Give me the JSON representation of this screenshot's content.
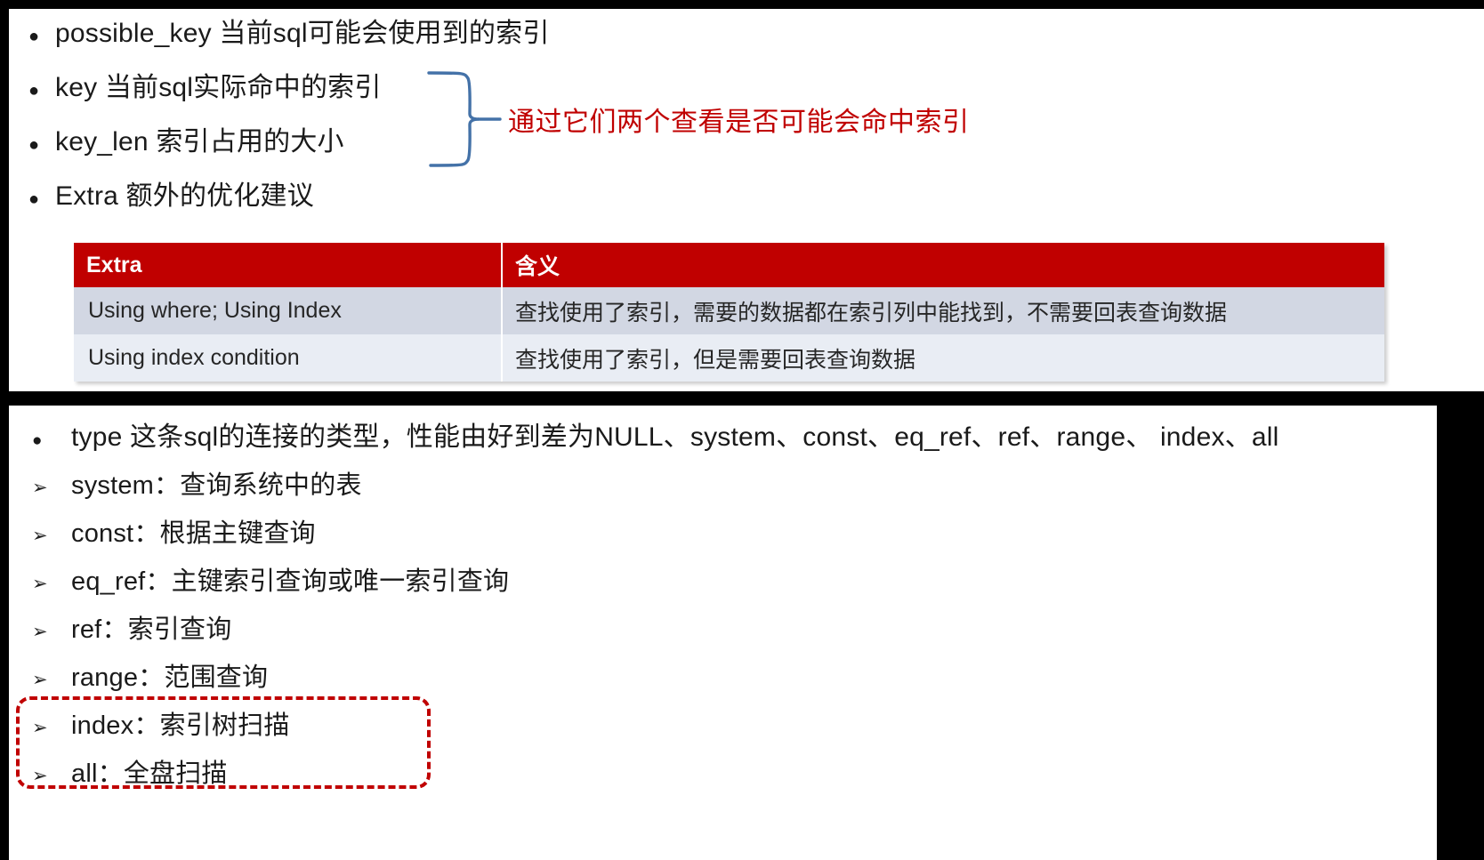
{
  "slide_top": {
    "bullets": [
      {
        "marker": "●",
        "text": "possible_key  当前sql可能会使用到的索引"
      },
      {
        "marker": "●",
        "text": "key 当前sql实际命中的索引"
      },
      {
        "marker": "●",
        "text": "key_len 索引占用的大小"
      },
      {
        "marker": "●",
        "text": "Extra 额外的优化建议"
      }
    ],
    "annotation": {
      "text": "通过它们两个查看是否可能会命中索引",
      "color": "#C00000",
      "brace_color": "#4472A8"
    },
    "table": {
      "header_bg": "#C00000",
      "header": [
        "Extra",
        "含义"
      ],
      "rows": [
        {
          "extra": "Using where; Using Index",
          "meaning": "查找使用了索引，需要的数据都在索引列中能找到，不需要回表查询数据",
          "bg": "#D2D7E3"
        },
        {
          "extra": "Using index condition",
          "meaning": "查找使用了索引，但是需要回表查询数据",
          "bg": "#E9EDF4"
        }
      ]
    }
  },
  "slide_bottom": {
    "items": [
      {
        "marker": "●",
        "text": "type 这条sql的连接的类型，性能由好到差为NULL、system、const、eq_ref、ref、range、 index、all",
        "lead": true
      },
      {
        "marker": "➢",
        "text": "system：查询系统中的表",
        "lead": false
      },
      {
        "marker": "➢",
        "text": "const：根据主键查询",
        "lead": false
      },
      {
        "marker": "➢",
        "text": "eq_ref：主键索引查询或唯一索引查询",
        "lead": false
      },
      {
        "marker": "➢",
        "text": "ref：索引查询",
        "lead": false
      },
      {
        "marker": "➢",
        "text": "range：范围查询",
        "lead": false
      },
      {
        "marker": "➢",
        "text": "index：索引树扫描",
        "lead": false
      },
      {
        "marker": "➢",
        "text": "all：全盘扫描",
        "lead": false
      }
    ],
    "highlight": {
      "color": "#C00000",
      "covers": [
        "index：索引树扫描",
        "all：全盘扫描"
      ]
    }
  }
}
